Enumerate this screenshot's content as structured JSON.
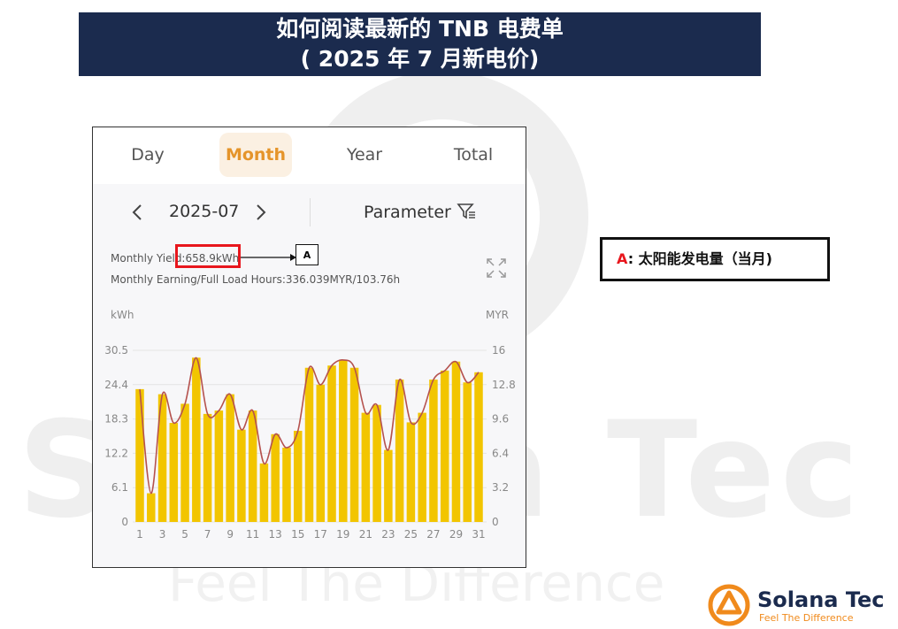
{
  "banner": {
    "line1": "如何阅读最新的 TNB 电费单",
    "line2": "( 2025 年 7 月新电价)"
  },
  "watermark": {
    "brand": "Solana Tec",
    "tagline": "Feel The Difference"
  },
  "app": {
    "tabs": [
      {
        "label": "Day",
        "active": false
      },
      {
        "label": "Month",
        "active": true
      },
      {
        "label": "Year",
        "active": false
      },
      {
        "label": "Total",
        "active": false
      }
    ],
    "date": "2025-07",
    "prev_icon": "chevron-left-icon",
    "next_icon": "chevron-right-icon",
    "parameter_label": "Parameter",
    "parameter_icon": "filter-icon",
    "monthly_yield": "Monthly Yield:658.9kWh",
    "monthly_earning": "Monthly Earning/Full Load Hours:336.039MYR/103.76h",
    "expand_icon": "expand-icon"
  },
  "annotation": {
    "tag": "A",
    "legend_letter": "A",
    "legend_text": ": 太阳能发电量（当月)",
    "color": "#e8161d"
  },
  "colors": {
    "bar": "#f2c500",
    "line": "#b5524e",
    "banner": "#1b2b4e",
    "accent": "#e5942a"
  },
  "chart_data": {
    "type": "bar",
    "left_unit": "kWh",
    "right_unit": "MYR",
    "left_ticks": [
      "0",
      "6.1",
      "12.2",
      "18.3",
      "24.4",
      "30.5"
    ],
    "right_ticks": [
      "0",
      "3.2",
      "6.4",
      "9.6",
      "12.8",
      "16"
    ],
    "ylim": [
      0,
      30.5
    ],
    "y2lim": [
      0,
      16
    ],
    "x_tick_labels": [
      "1",
      "3",
      "5",
      "7",
      "9",
      "11",
      "13",
      "15",
      "17",
      "19",
      "21",
      "23",
      "25",
      "27",
      "29",
      "31"
    ],
    "categories": [
      1,
      2,
      3,
      4,
      5,
      6,
      7,
      8,
      9,
      10,
      11,
      12,
      13,
      14,
      15,
      16,
      17,
      18,
      19,
      20,
      21,
      22,
      23,
      24,
      25,
      26,
      27,
      28,
      29,
      30,
      31
    ],
    "series": [
      {
        "name": "kWh",
        "type": "bar",
        "values": [
          23.6,
          5.1,
          22.7,
          17.6,
          21.0,
          29.2,
          19.2,
          19.8,
          22.7,
          16.4,
          19.8,
          10.4,
          15.6,
          13.2,
          16.2,
          27.4,
          24.4,
          27.8,
          28.8,
          27.4,
          19.4,
          20.8,
          12.8,
          25.3,
          17.7,
          19.4,
          25.3,
          26.9,
          28.5,
          24.8,
          26.6
        ]
      },
      {
        "name": "MYR",
        "type": "line",
        "values": [
          12.37,
          2.67,
          11.9,
          9.23,
          11.0,
          15.3,
          10.07,
          10.38,
          11.9,
          8.6,
          10.38,
          5.45,
          8.18,
          6.92,
          8.49,
          14.37,
          12.79,
          14.58,
          15.1,
          14.37,
          10.17,
          10.9,
          6.71,
          13.27,
          9.28,
          10.17,
          13.27,
          14.1,
          14.94,
          13.0,
          13.95
        ]
      }
    ]
  },
  "brand": {
    "name": "Solana Tec",
    "tagline": "Feel The Difference"
  }
}
